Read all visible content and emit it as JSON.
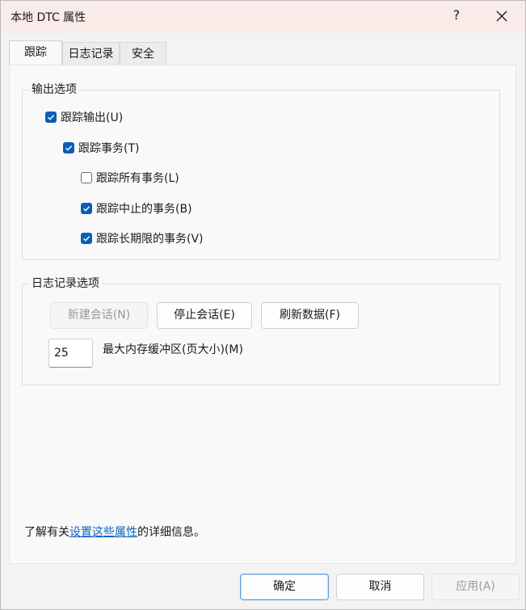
{
  "window": {
    "title": "本地 DTC 属性",
    "help_label": "?"
  },
  "tabs": [
    {
      "label": "跟踪",
      "active": true
    },
    {
      "label": "日志记录",
      "active": false
    },
    {
      "label": "安全",
      "active": false
    }
  ],
  "output_options": {
    "legend": "输出选项",
    "trace_output": {
      "label": "跟踪输出(U)",
      "checked": true
    },
    "trace_transactions": {
      "label": "跟踪事务(T)",
      "checked": true
    },
    "trace_all": {
      "label": "跟踪所有事务(L)",
      "checked": false
    },
    "trace_aborted": {
      "label": "跟踪中止的事务(B)",
      "checked": true
    },
    "trace_long": {
      "label": "跟踪长期限的事务(V)",
      "checked": true
    }
  },
  "logging_options": {
    "legend": "日志记录选项",
    "new_session": "新建会话(N)",
    "stop_session": "停止会话(E)",
    "refresh_data": "刷新数据(F)",
    "buffer_value": "25",
    "buffer_label": "最大内存缓冲区(页大小)(M)"
  },
  "info": {
    "prefix": "了解有关",
    "link": "设置这些属性",
    "suffix": "的详细信息。"
  },
  "footer": {
    "ok": "确定",
    "cancel": "取消",
    "apply": "应用(A)"
  },
  "colors": {
    "accent": "#0a5fb4",
    "link": "#0b63c5",
    "titlebar": "#f9ebe8"
  }
}
